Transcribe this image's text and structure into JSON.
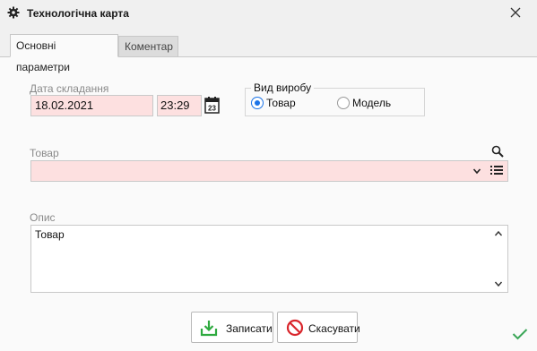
{
  "window": {
    "title": "Технологічна карта"
  },
  "tabs": [
    {
      "label": "Основні параметри",
      "active": true
    },
    {
      "label": "Коментар",
      "active": false
    }
  ],
  "form": {
    "date_label": "Дата складання",
    "date_value": "18.02.2021",
    "time_value": "23:29",
    "calendar_day": "23",
    "product_type": {
      "title": "Вид виробу",
      "options": [
        {
          "label": "Товар",
          "selected": true
        },
        {
          "label": "Модель",
          "selected": false
        }
      ]
    },
    "product_label": "Товар",
    "product_value": "",
    "description_label": "Опис",
    "description_value": "Товар"
  },
  "buttons": {
    "save": "Записати",
    "cancel": "Скасувати"
  },
  "colors": {
    "required_bg": "#fde0e0",
    "accent": "#1a73e8",
    "save_icon": "#2eaa3f",
    "cancel_icon": "#d9262c",
    "ok_check": "#3aa657"
  },
  "icons": [
    "gear-icon",
    "close-icon",
    "calendar-icon",
    "search-icon",
    "chevron-down-icon",
    "list-icon",
    "save-icon",
    "cancel-icon",
    "check-icon"
  ]
}
